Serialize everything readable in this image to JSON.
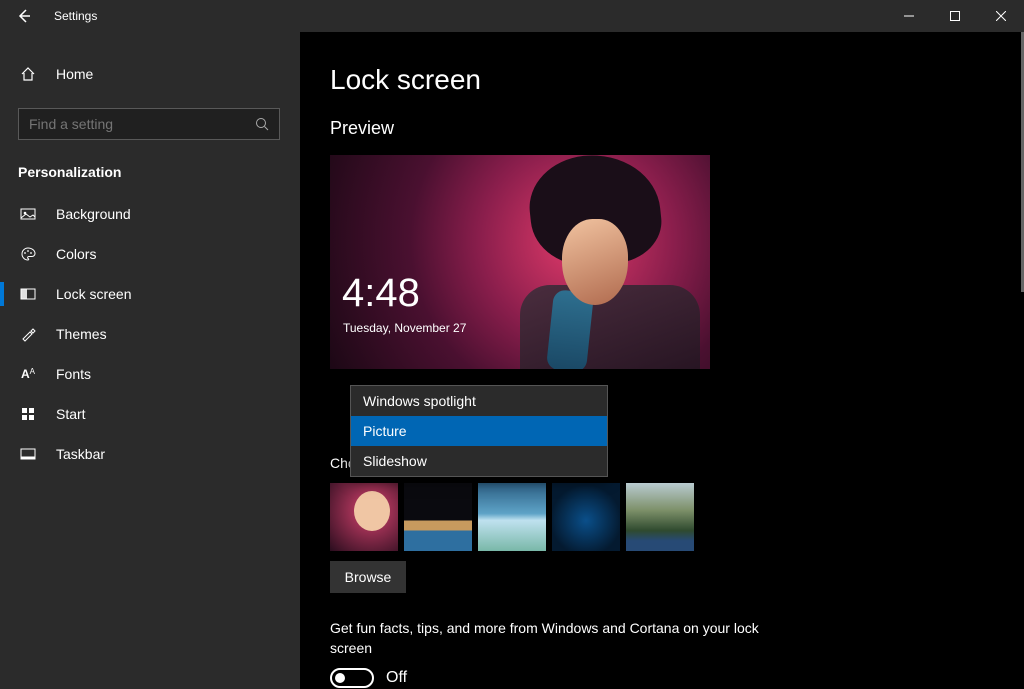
{
  "window": {
    "title": "Settings"
  },
  "sidebar": {
    "home_label": "Home",
    "search_placeholder": "Find a setting",
    "category": "Personalization",
    "items": [
      {
        "label": "Background"
      },
      {
        "label": "Colors"
      },
      {
        "label": "Lock screen"
      },
      {
        "label": "Themes"
      },
      {
        "label": "Fonts"
      },
      {
        "label": "Start"
      },
      {
        "label": "Taskbar"
      }
    ]
  },
  "main": {
    "page_title": "Lock screen",
    "preview_label": "Preview",
    "preview_time": "4:48",
    "preview_date": "Tuesday, November 27",
    "background_dropdown": {
      "options": [
        "Windows spotlight",
        "Picture",
        "Slideshow"
      ],
      "selected": "Picture"
    },
    "choose_picture_label": "Choose your picture",
    "browse_label": "Browse",
    "fun_facts_text": "Get fun facts, tips, and more from Windows and Cortana on your lock screen",
    "fun_facts_toggle": {
      "state": "Off"
    }
  }
}
